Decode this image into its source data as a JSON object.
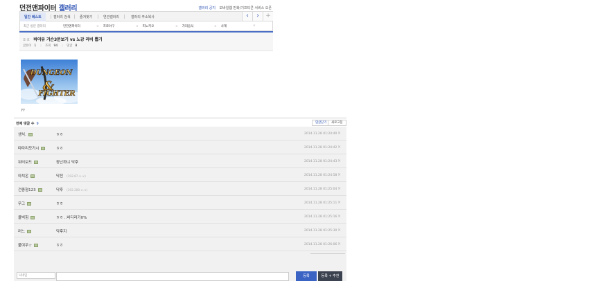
{
  "header": {
    "title_main": "던전앤파이터",
    "title_accent": "갤러리",
    "gallery_notice": "갤러리 공지",
    "mobile_service": "모바일웹 만화/기프티콘 서비스 오픈"
  },
  "tabs": [
    "일간 베스트",
    "갤러리 검색",
    "즐겨찾기",
    "연관갤러리",
    "갤러리 주소복사"
  ],
  "nav": {
    "prev": "‹",
    "next": "›",
    "add": "+"
  },
  "recent": {
    "label": "최근 방문 갤러리",
    "items": [
      "던전앤파이터",
      "프로야구",
      "피노키오",
      "가리음식",
      "사계"
    ]
  },
  "post": {
    "badge": "호·호",
    "title": "바이유 거슨3문보기 vs 노강 라비 뽑기",
    "meta_view_label": "글쓴이",
    "meta_view": "1",
    "meta_hit_label": "조회",
    "meta_hit": "94",
    "meta_reply_label": "댓글",
    "meta_reply": "8",
    "image_text_top": "DUNGEON",
    "image_text_bottom": "FIGHTER",
    "body": "??"
  },
  "comments_header": {
    "label": "전체 댓글 수",
    "count": "9",
    "btn_open": "댓글닫기",
    "btn_refresh": "새로고침"
  },
  "comments": [
    {
      "nick": "생식.",
      "text": "ㅎㅎ",
      "ip": "",
      "date": "2014.11.28 01:24:40"
    },
    {
      "nick": "타타리모가시",
      "text": "ㅎㅎ",
      "ip": "",
      "date": "2014.11.28 01:24:42"
    },
    {
      "nick": "뒤터보드",
      "text": "장난하냐 닥후",
      "ip": "",
      "date": "2014.11.28 01:24:43"
    },
    {
      "nick": "아치온",
      "text": "닥전",
      "ip": "(192.87.×.×)",
      "date": "2014.11.28 01:24:58"
    },
    {
      "nick": "건종형123",
      "text": "닥후",
      "ip": "(192.200.×.×)",
      "date": "2014.11.28 01:25:04"
    },
    {
      "nick": "무그",
      "text": "ㅎㅎ",
      "ip": "",
      "date": "2014.11.28 01:25:11"
    },
    {
      "nick": "올빅힘",
      "text": "ㅎㅎ ..버디러기0%",
      "ip": "",
      "date": "2014.11.28 01:25:16"
    },
    {
      "nick": "러느",
      "text": "닥후지",
      "ip": "",
      "date": "2014.11.28 01:25:30"
    },
    {
      "nick": "붙여우☆",
      "text": "ㅎㅎ",
      "ip": "",
      "date": "2014.11.28 01:26:06"
    }
  ],
  "footer_buttons": {
    "btn_open": "댓글닫기",
    "btn_refresh": "새로고침"
  },
  "writer": {
    "nick_placeholder": "닉네임",
    "submit": "등록",
    "submit_recommend": "등록 + 추천"
  },
  "colors": {
    "accent": "#2c52b3",
    "submit": "#3b63c4",
    "submit_recommend": "#3c4350"
  }
}
